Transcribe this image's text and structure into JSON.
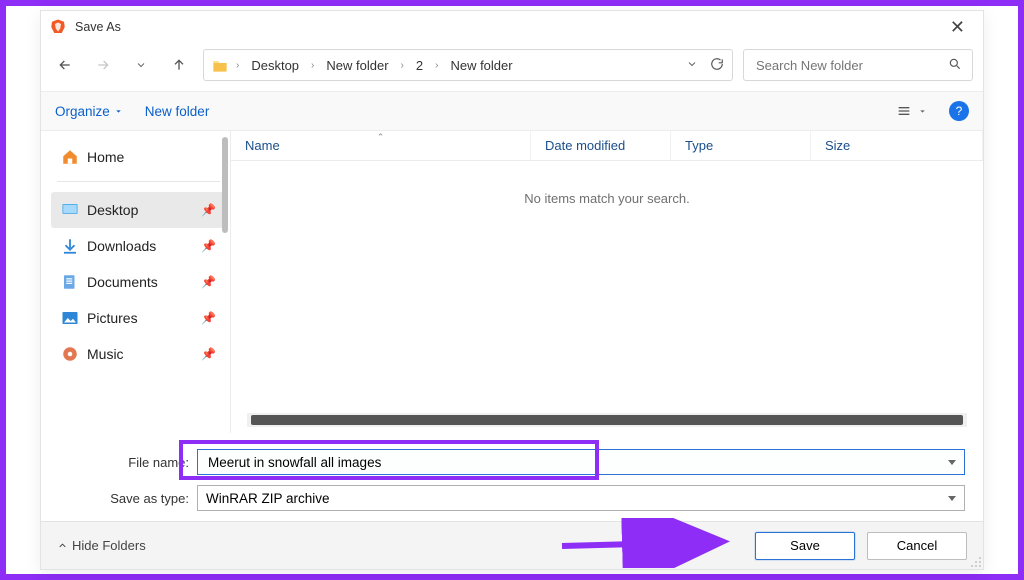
{
  "window": {
    "title": "Save As"
  },
  "breadcrumbs": {
    "items": [
      "Desktop",
      "New folder",
      "2",
      "New folder"
    ]
  },
  "search": {
    "placeholder": "Search New folder"
  },
  "toolbar": {
    "organize": "Organize",
    "newfolder": "New folder",
    "help_glyph": "?"
  },
  "sidebar": {
    "items": [
      {
        "label": "Home",
        "icon": "home",
        "pinned": false,
        "selected": false
      },
      {
        "label": "Desktop",
        "icon": "desktop",
        "pinned": true,
        "selected": true
      },
      {
        "label": "Downloads",
        "icon": "download",
        "pinned": true,
        "selected": false
      },
      {
        "label": "Documents",
        "icon": "documents",
        "pinned": true,
        "selected": false
      },
      {
        "label": "Pictures",
        "icon": "pictures",
        "pinned": true,
        "selected": false
      },
      {
        "label": "Music",
        "icon": "music",
        "pinned": true,
        "selected": false
      }
    ]
  },
  "columns": {
    "name": "Name",
    "date": "Date modified",
    "type": "Type",
    "size": "Size"
  },
  "empty_msg": "No items match your search.",
  "inputs": {
    "filename_label": "File name:",
    "filename_value": "Meerut in snowfall all images",
    "type_label": "Save as type:",
    "type_value": "WinRAR ZIP archive"
  },
  "footer": {
    "hide_folders": "Hide Folders",
    "save": "Save",
    "cancel": "Cancel"
  }
}
